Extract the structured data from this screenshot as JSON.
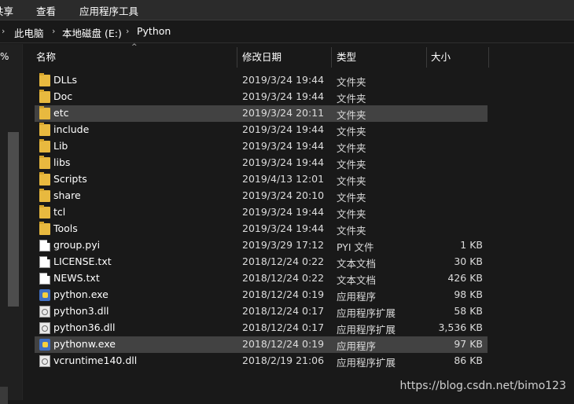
{
  "ribbon": {
    "tabs": [
      "共享",
      "查看",
      "应用程序工具"
    ]
  },
  "address": {
    "crumbs": [
      "此电脑",
      "本地磁盘 (E:)",
      "Python"
    ]
  },
  "left_pane": {
    "label": "%"
  },
  "columns": {
    "name": "名称",
    "modified": "修改日期",
    "type": "类型",
    "size": "大小"
  },
  "files": [
    {
      "name": "DLLs",
      "modified": "2019/3/24 19:44",
      "type": "文件夹",
      "size": "",
      "icon": "folder-icon"
    },
    {
      "name": "Doc",
      "modified": "2019/3/24 19:44",
      "type": "文件夹",
      "size": "",
      "icon": "folder-icon"
    },
    {
      "name": "etc",
      "modified": "2019/3/24 20:11",
      "type": "文件夹",
      "size": "",
      "icon": "folder-icon"
    },
    {
      "name": "include",
      "modified": "2019/3/24 19:44",
      "type": "文件夹",
      "size": "",
      "icon": "folder-icon"
    },
    {
      "name": "Lib",
      "modified": "2019/3/24 19:44",
      "type": "文件夹",
      "size": "",
      "icon": "folder-icon"
    },
    {
      "name": "libs",
      "modified": "2019/3/24 19:44",
      "type": "文件夹",
      "size": "",
      "icon": "folder-icon"
    },
    {
      "name": "Scripts",
      "modified": "2019/4/13 12:01",
      "type": "文件夹",
      "size": "",
      "icon": "folder-icon"
    },
    {
      "name": "share",
      "modified": "2019/3/24 20:10",
      "type": "文件夹",
      "size": "",
      "icon": "folder-icon"
    },
    {
      "name": "tcl",
      "modified": "2019/3/24 19:44",
      "type": "文件夹",
      "size": "",
      "icon": "folder-icon"
    },
    {
      "name": "Tools",
      "modified": "2019/3/24 19:44",
      "type": "文件夹",
      "size": "",
      "icon": "folder-icon"
    },
    {
      "name": "group.pyi",
      "modified": "2019/3/29 17:12",
      "type": "PYI 文件",
      "size": "1 KB",
      "icon": "document-icon"
    },
    {
      "name": "LICENSE.txt",
      "modified": "2018/12/24 0:22",
      "type": "文本文档",
      "size": "30 KB",
      "icon": "text-document-icon"
    },
    {
      "name": "NEWS.txt",
      "modified": "2018/12/24 0:22",
      "type": "文本文档",
      "size": "426 KB",
      "icon": "text-document-icon"
    },
    {
      "name": "python.exe",
      "modified": "2018/12/24 0:19",
      "type": "应用程序",
      "size": "98 KB",
      "icon": "python-exe-icon"
    },
    {
      "name": "python3.dll",
      "modified": "2018/12/24 0:17",
      "type": "应用程序扩展",
      "size": "58 KB",
      "icon": "dll-icon"
    },
    {
      "name": "python36.dll",
      "modified": "2018/12/24 0:17",
      "type": "应用程序扩展",
      "size": "3,536 KB",
      "icon": "dll-icon"
    },
    {
      "name": "pythonw.exe",
      "modified": "2018/12/24 0:19",
      "type": "应用程序",
      "size": "97 KB",
      "icon": "python-exe-icon"
    },
    {
      "name": "vcruntime140.dll",
      "modified": "2018/2/19 21:06",
      "type": "应用程序扩展",
      "size": "86 KB",
      "icon": "dll-icon"
    }
  ],
  "selected_rows": [
    "etc",
    "pythonw.exe"
  ],
  "watermark": "https://blog.csdn.net/bimo123",
  "colors": {
    "background": "#191919",
    "selection": "#424242",
    "folder": "#e8b93f"
  }
}
